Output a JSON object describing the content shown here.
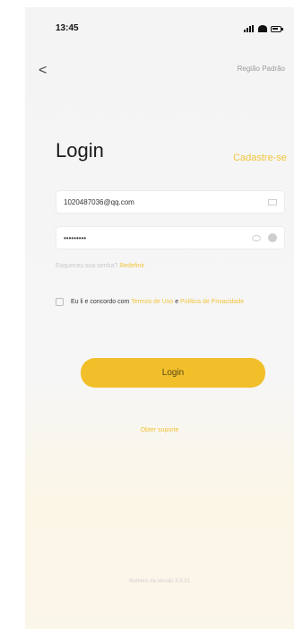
{
  "status_bar": {
    "time": "13:45"
  },
  "nav": {
    "back_glyph": "<",
    "region": "Região Padrão"
  },
  "title": "Login",
  "signup_label": "Cadastre-se",
  "email": {
    "value": "1020487036@qq.com"
  },
  "password": {
    "masked_value": "•••••••••"
  },
  "forgot": {
    "text": "Esqueceu sua senha?",
    "link": "Redefinir"
  },
  "agreement": {
    "prefix": "Eu li e concordo com",
    "terms": "Termos de Uso",
    "and": "e",
    "privacy": "Política de Privacidade"
  },
  "login_button": "Login",
  "support": "Obter suporte",
  "version": "Número da versão 3.3.31",
  "colors": {
    "accent": "#f1bf2a",
    "link": "#f1c43b"
  }
}
